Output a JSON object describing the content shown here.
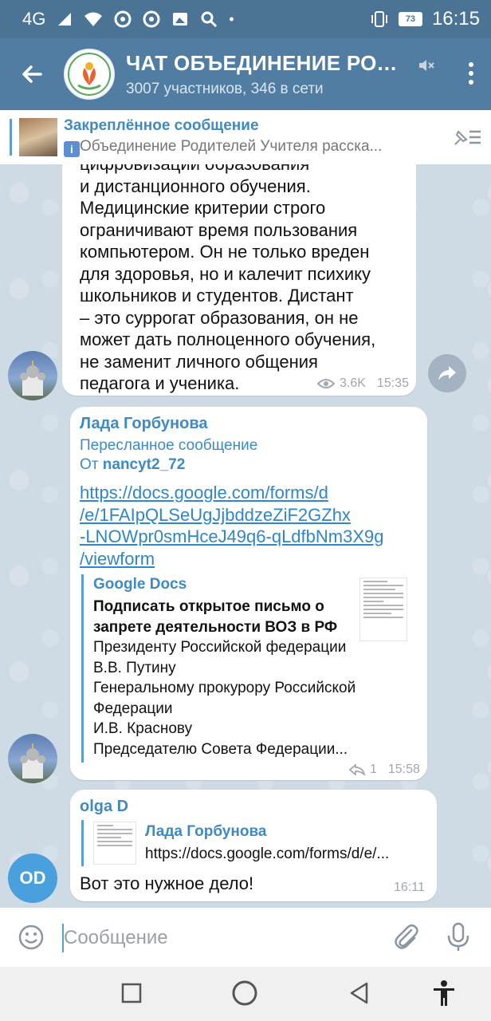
{
  "status_bar": {
    "network": "4G",
    "battery": "73",
    "time": "16:15"
  },
  "header": {
    "title": "ЧАТ ОБЪЕДИНЕНИЕ РОДИ...",
    "subtitle": "3007 участников, 346 в сети"
  },
  "pinned": {
    "title": "Закреплённое сообщение",
    "text": "Объединение Родителей   Учителя расска..."
  },
  "messages": {
    "m1": {
      "partial_line": "цифровизации образования",
      "lines": [
        "и дистанционного обучения.",
        "Медицинские критерии строго",
        "ограничивают время пользования",
        "компьютером. Он не только вреден",
        "для здоровья, но и калечит психику",
        "школьников и студентов. Дистант",
        "– это суррогат образования, он не",
        "может дать полноценного обучения,",
        "не заменит личного общения",
        "педагога и ученика."
      ],
      "views": "3.6K",
      "time": "15:35"
    },
    "m2": {
      "sender": "Лада Горбунова",
      "forwarded_label": "Пересланное сообщение",
      "from_prefix": "От ",
      "from_user": "nancyt2_72",
      "link_lines": [
        "https://docs.google.com/forms/d",
        "/e/1FAIpQLSeUgJjbddzeZiF2GZhx",
        "-LNOWpr0smHceJ49q6-qLdfbNm3X9g",
        "/viewform"
      ],
      "preview": {
        "site": "Google Docs",
        "title_lines": [
          "Подписать открытое письмо о",
          "запрете деятельности ВОЗ в РФ"
        ],
        "desc_lines": [
          "Президенту Российской федерации",
          "В.В. Путину",
          "Генеральному прокурору Российской",
          "Федерации",
          "И.В. Краснову",
          "Председателю Совета Федерации..."
        ]
      },
      "replies": "1",
      "time": "15:58"
    },
    "m3": {
      "sender": "olga D",
      "reply_author": "Лада Горбунова",
      "reply_text": "https://docs.google.com/forms/d/e/...",
      "text": "Вот это нужное дело!",
      "time": "16:11",
      "avatar_initials": "OD"
    }
  },
  "composer": {
    "placeholder": "Сообщение"
  },
  "colors": {
    "header": "#527da3",
    "status_bar": "#4a7396",
    "accent": "#3f8ac2",
    "link": "#2f86c8",
    "chat_bg": "#cfdbe4"
  }
}
